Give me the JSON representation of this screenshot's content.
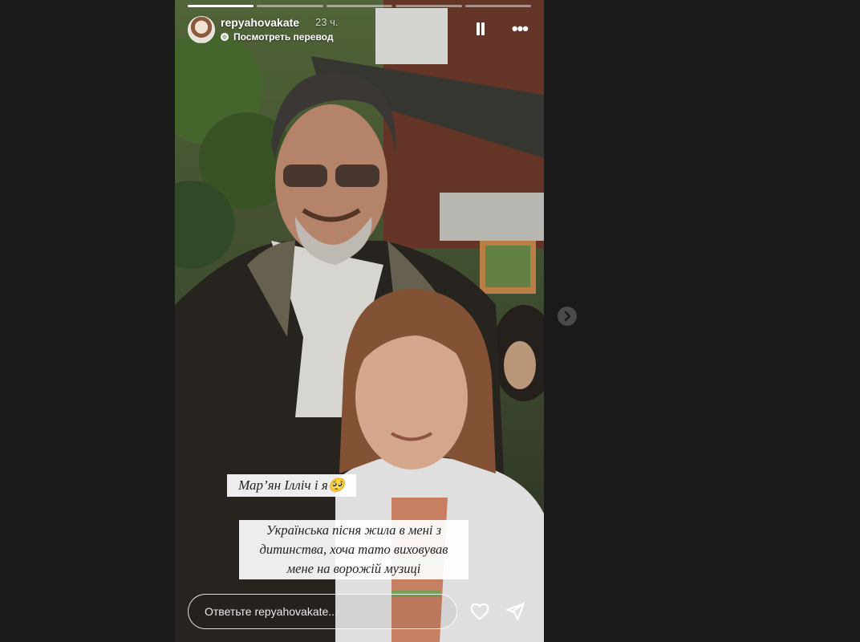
{
  "story": {
    "username": "repyahovakate",
    "time": "23 ч.",
    "translate_label": "Посмотреть перевод",
    "progress": {
      "total": 5,
      "completed": 1
    },
    "caption1": "Мар’ян Ілліч і я🥺",
    "caption2_lines": [
      "Українська пісня жила в мені з",
      "дитинства, хоча тато виховував",
      "мене на ворожій музиці"
    ],
    "reply_placeholder": "Ответьте repyahovakate..."
  },
  "icons": {
    "pause": "pause-icon",
    "more": "more-icon",
    "heart": "heart-icon",
    "send": "send-icon",
    "next": "chevron-right-icon",
    "translate": "translate-icon"
  },
  "colors": {
    "page_bg": "#1a1a1a",
    "text": "#ffffff",
    "sticker_bg": "#ffffff"
  }
}
